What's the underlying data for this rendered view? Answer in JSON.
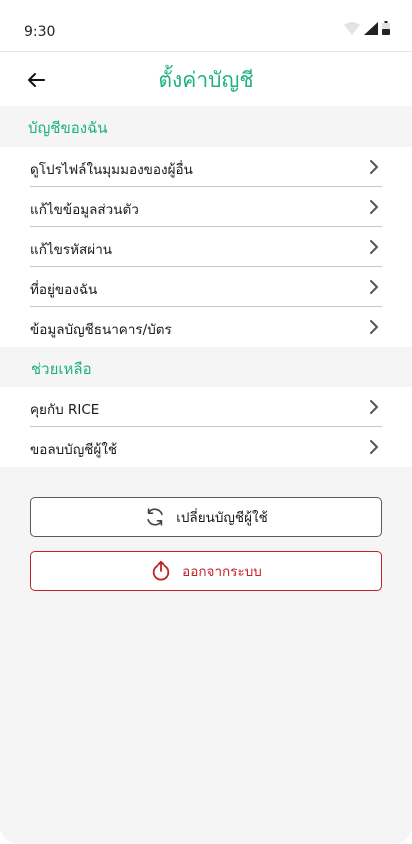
{
  "status_bar": {
    "time": "9:30"
  },
  "header": {
    "title": "ตั้งค่าบัญชี",
    "back_icon": "arrow-left-icon"
  },
  "sections": [
    {
      "title": "บัญชีของฉัน",
      "items": [
        {
          "label": "ดูโปรไฟล์ในมุมมองของผู้อื่น"
        },
        {
          "label": "แก้ไขข้อมูลส่วนตัว"
        },
        {
          "label": "แก้ไขรหัสผ่าน"
        },
        {
          "label": "ที่อยู่ของฉัน"
        },
        {
          "label": "ข้อมูลบัญชีธนาคาร/บัตร"
        }
      ]
    },
    {
      "title": "ช่วยเหลือ",
      "items": [
        {
          "label": "คุยกับ RICE"
        },
        {
          "label": "ขอลบบัญชีผู้ใช้"
        }
      ]
    }
  ],
  "actions": {
    "switch_account": "เปลี่ยนบัญชีผู้ใช้",
    "logout": "ออกจากระบบ"
  },
  "colors": {
    "accent": "#20b27a",
    "danger": "#c0242a"
  }
}
